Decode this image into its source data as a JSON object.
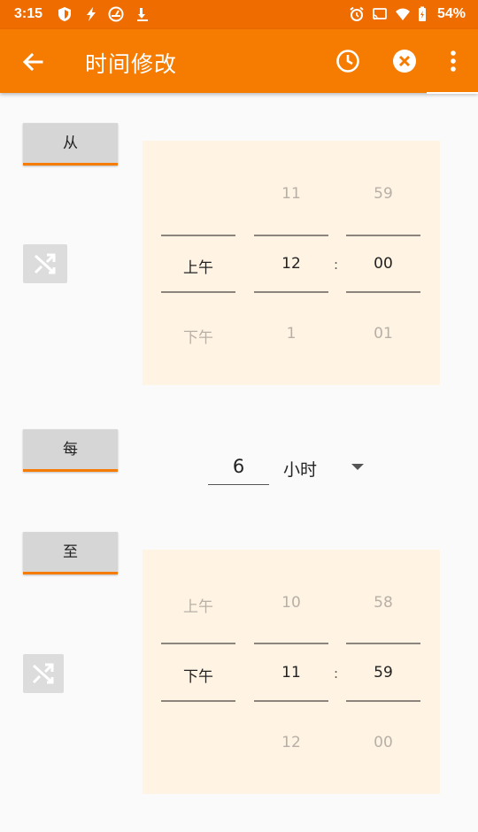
{
  "status_bar": {
    "time": "3:15",
    "battery": "54%"
  },
  "toolbar": {
    "title": "时间修改"
  },
  "from_section": {
    "label": "从",
    "ampm": {
      "prev": "",
      "selected": "上午",
      "next": "下午"
    },
    "hour": {
      "prev": "11",
      "selected": "12",
      "next": "1"
    },
    "minute": {
      "prev": "59",
      "selected": "00",
      "next": "01"
    },
    "separator": ":"
  },
  "every_section": {
    "label": "每",
    "value": "6",
    "unit": "小时"
  },
  "to_section": {
    "label": "至",
    "ampm": {
      "prev": "上午",
      "selected": "下午",
      "next": ""
    },
    "hour": {
      "prev": "10",
      "selected": "11",
      "next": "12"
    },
    "minute": {
      "prev": "58",
      "selected": "59",
      "next": "00"
    },
    "separator": ":"
  },
  "colors": {
    "toolbar": "#f57c00",
    "status_bar": "#ef6c00",
    "picker_bg": "#fff3e3",
    "accent": "#f57c00"
  }
}
